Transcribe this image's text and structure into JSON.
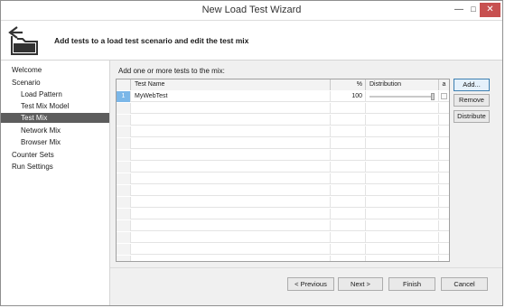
{
  "window": {
    "title": "New Load Test Wizard"
  },
  "header": {
    "text": "Add tests to a load test scenario and edit the test mix",
    "icon": "wizard-icon"
  },
  "nav": {
    "items": [
      {
        "label": "Welcome",
        "level": 0,
        "selected": false
      },
      {
        "label": "Scenario",
        "level": 0,
        "selected": false
      },
      {
        "label": "Load Pattern",
        "level": 1,
        "selected": false
      },
      {
        "label": "Test Mix Model",
        "level": 1,
        "selected": false
      },
      {
        "label": "Test Mix",
        "level": 1,
        "selected": true
      },
      {
        "label": "Network Mix",
        "level": 1,
        "selected": false
      },
      {
        "label": "Browser Mix",
        "level": 1,
        "selected": false
      },
      {
        "label": "Counter Sets",
        "level": 0,
        "selected": false
      },
      {
        "label": "Run Settings",
        "level": 0,
        "selected": false
      }
    ]
  },
  "main": {
    "instruction": "Add one or more tests to the mix:",
    "grid": {
      "columns": [
        "",
        "Test Name",
        "%",
        "Distribution",
        "a"
      ],
      "rows": [
        {
          "index": "1",
          "name": "MyWebTest",
          "percent": "100",
          "distribution": 1.0
        }
      ],
      "empty_rows": 14
    },
    "side_buttons": {
      "add": "Add...",
      "remove": "Remove",
      "distribute": "Distribute"
    }
  },
  "footer": {
    "previous": "< Previous",
    "next": "Next >",
    "finish": "Finish",
    "cancel": "Cancel"
  },
  "colors": {
    "selected_nav": "#5d5d5d",
    "close_button": "#c75050",
    "row_selected": "#7bb7e8"
  }
}
